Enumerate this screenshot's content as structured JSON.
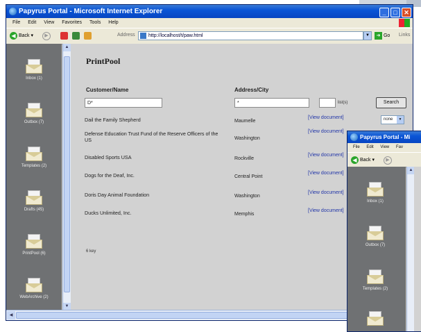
{
  "main_window": {
    "title": "Papyrus Portal - Microsoft Internet Explorer",
    "menu": [
      "File",
      "Edit",
      "View",
      "Favorites",
      "Tools",
      "Help"
    ],
    "toolbar": {
      "back_label": "Back",
      "address_label": "Address",
      "address_value": "http://localhost/t/paw.html",
      "go_label": "Go",
      "links_label": "Links"
    },
    "sidebar": [
      {
        "label": "Inbox (1)",
        "icon": "envelope-icon"
      },
      {
        "label": "Outbox (7)",
        "icon": "envelope-icon"
      },
      {
        "label": "Templates (2)",
        "icon": "envelope-icon"
      },
      {
        "label": "Drafts (45)",
        "icon": "envelope-icon"
      },
      {
        "label": "PrintPool (6)",
        "icon": "envelope-icon"
      },
      {
        "label": "WebArchive (2)",
        "icon": "envelope-icon"
      }
    ],
    "content": {
      "title": "PrintPool",
      "col_customer": "Customer/Name",
      "col_address": "Address/City",
      "customer_filter": "D*",
      "address_filter": "*",
      "list_label": "list(s)",
      "list_value": "",
      "search_label": "Search",
      "select_value": "none",
      "rows": [
        {
          "name": "Dail the Family Shepherd",
          "city": "Maumelle",
          "link": "[View document]"
        },
        {
          "name": "Defense Education Trust Fund of the Reserve Officers of the US",
          "city": "Washington",
          "link": "[View document]"
        },
        {
          "name": "Disabled Sports USA",
          "city": "Rockville",
          "link": "[View document]"
        },
        {
          "name": "Dogs for the Deaf, Inc.",
          "city": "Central Point",
          "link": "[View document]"
        },
        {
          "name": "Doris Day Animal Foundation",
          "city": "Washington",
          "link": "[View document]"
        },
        {
          "name": "Ducks Unlimited, Inc.",
          "city": "Memphis",
          "link": "[View document]"
        }
      ],
      "footer_text": "6 key"
    }
  },
  "second_window": {
    "title": "Papyrus Portal - Mi",
    "menu": [
      "File",
      "Edit",
      "View",
      "Fav"
    ],
    "back_label": "Back",
    "sidebar": [
      {
        "label": "Inbox (1)",
        "icon": "envelope-icon"
      },
      {
        "label": "Outbox (7)",
        "icon": "envelope-icon"
      },
      {
        "label": "Templates (2)",
        "icon": "envelope-icon"
      }
    ]
  },
  "colors": {
    "titlebar": "#0a55d6",
    "sidebar": "#6f7173",
    "content_bg": "#d2d2d2",
    "link": "#2236a8"
  }
}
